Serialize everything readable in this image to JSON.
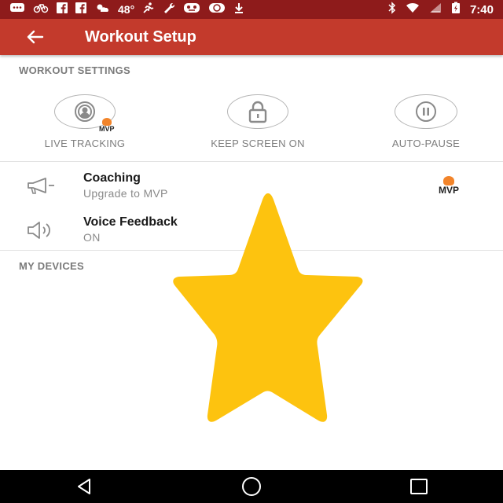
{
  "status_bar": {
    "temperature": "48°",
    "time": "7:40",
    "left_icons": [
      "chat-icon",
      "bike-icon",
      "facebook-icon",
      "facebook-icon",
      "weather-icon",
      "runner-icon",
      "wrench-icon",
      "mask-icon",
      "chain-icon",
      "download-icon"
    ],
    "right_icons": [
      "bluetooth-icon",
      "wifi-icon",
      "signal-icon",
      "battery-icon"
    ]
  },
  "app_bar": {
    "title": "Workout Setup",
    "back_icon": "arrow-left-icon",
    "color": "#c33a2c"
  },
  "workout_settings": {
    "heading": "WORKOUT SETTINGS",
    "tiles": [
      {
        "label": "LIVE TRACKING",
        "icon": "live-tracking-icon",
        "badge": "MVP"
      },
      {
        "label": "KEEP SCREEN ON",
        "icon": "lock-icon"
      },
      {
        "label": "AUTO-PAUSE",
        "icon": "pause-icon"
      }
    ]
  },
  "settings_rows": [
    {
      "title": "Coaching",
      "subtitle": "Upgrade to MVP",
      "icon": "megaphone-icon",
      "badge": "MVP"
    },
    {
      "title": "Voice Feedback",
      "subtitle": "ON",
      "icon": "speaker-icon"
    }
  ],
  "my_devices": {
    "heading": "MY DEVICES"
  },
  "overlay": {
    "icon": "star-icon",
    "color": "#fdc30f"
  },
  "nav_bar": {
    "icons": [
      "back-triangle-icon",
      "home-circle-icon",
      "recents-square-icon"
    ]
  }
}
